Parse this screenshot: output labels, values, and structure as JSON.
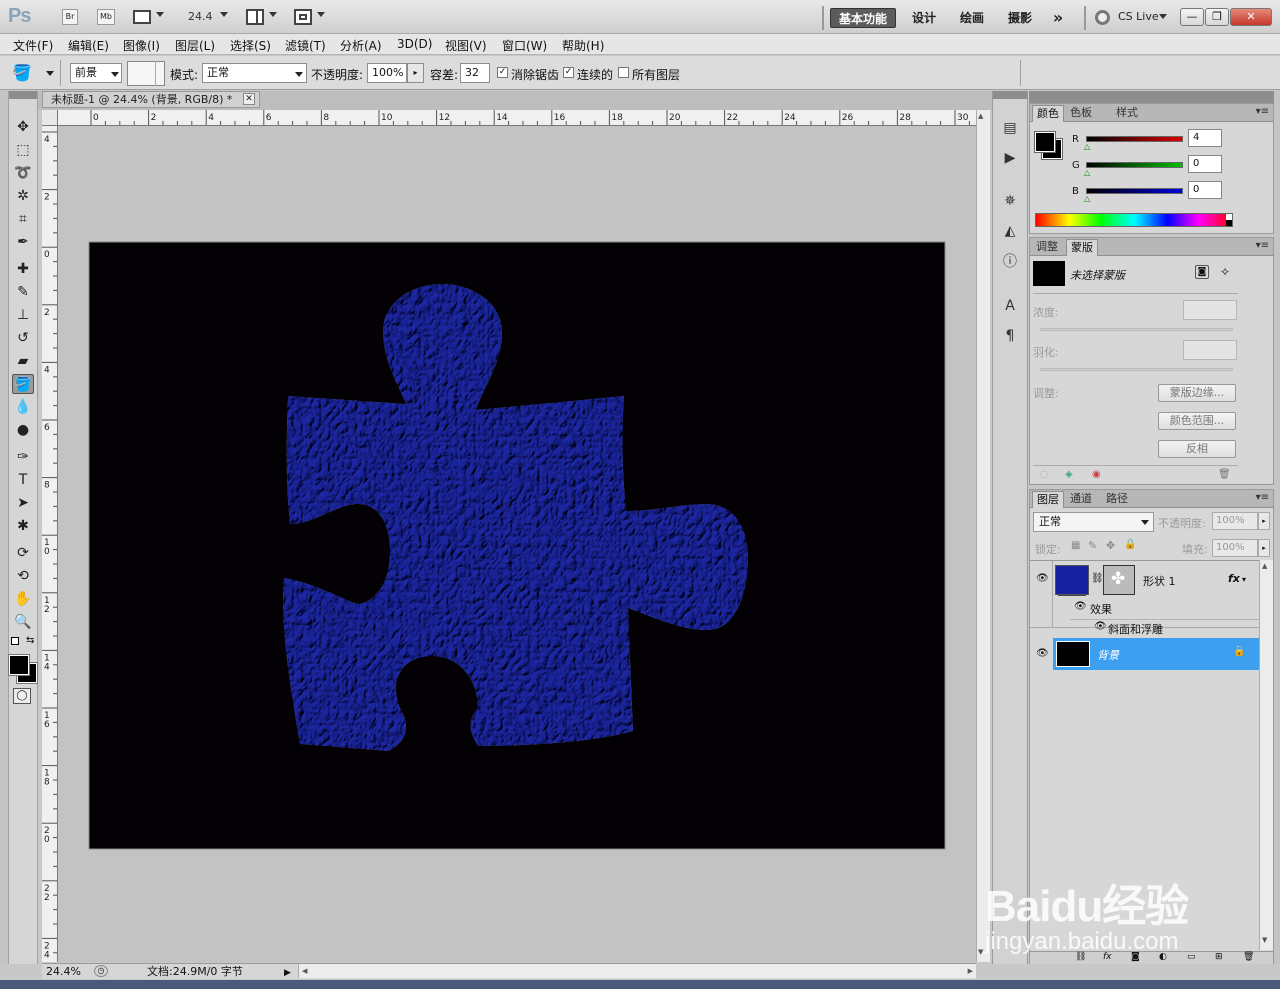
{
  "app": {
    "logo": "Ps",
    "bridge_label": "Br",
    "minibridge_label": "Mb",
    "zoom_level": "24.4",
    "workspaces": [
      "基本功能",
      "设计",
      "绘画",
      "摄影"
    ],
    "more_workspaces": "»",
    "cs_live": "CS Live",
    "window_buttons": [
      "minimize",
      "restore",
      "close"
    ]
  },
  "menu": [
    "文件(F)",
    "编辑(E)",
    "图像(I)",
    "图层(L)",
    "选择(S)",
    "滤镜(T)",
    "分析(A)",
    "3D(D)",
    "视图(V)",
    "窗口(W)",
    "帮助(H)"
  ],
  "options": {
    "fill_source": "前景",
    "mode_label": "模式:",
    "mode_value": "正常",
    "opacity_label": "不透明度:",
    "opacity_value": "100%",
    "tolerance_label": "容差:",
    "tolerance_value": "32",
    "antialias_label": "消除锯齿",
    "antialias_checked": true,
    "contiguous_label": "连续的",
    "contiguous_checked": true,
    "all_layers_label": "所有图层",
    "all_layers_checked": false
  },
  "document": {
    "tab_title": "未标题-1 @ 24.4% (背景, RGB/8) *",
    "ruler_h_labels": [
      "0",
      "2",
      "4",
      "6",
      "8",
      "10",
      "12",
      "14",
      "16",
      "18",
      "20",
      "22",
      "24",
      "26",
      "28",
      "30"
    ],
    "ruler_v_labels": [
      "4",
      "2",
      "0",
      "2",
      "4",
      "6",
      "8",
      "10",
      "12",
      "14",
      "16",
      "18",
      "20",
      "22",
      "24"
    ],
    "canvas_color": "#030104",
    "shape_color": "#2e3aa8",
    "zoom_status": "24.4%",
    "doc_size": "文档:24.9M/0 字节"
  },
  "color_panel": {
    "tabs": [
      "颜色",
      "色板",
      "样式"
    ],
    "active_tab": "颜色",
    "channels": [
      {
        "name": "R",
        "value": "4",
        "color": "#e00000"
      },
      {
        "name": "G",
        "value": "0",
        "color": "#00c000"
      },
      {
        "name": "B",
        "value": "0",
        "color": "#0000e0"
      }
    ]
  },
  "masks_panel": {
    "tabs": [
      "调整",
      "蒙版"
    ],
    "active_tab": "蒙版",
    "mask_label": "未选择蒙版",
    "density_label": "浓度:",
    "feather_label": "羽化:",
    "refine_label": "调整:",
    "buttons": [
      "蒙版边缘...",
      "颜色范围...",
      "反相"
    ]
  },
  "layers_panel": {
    "tabs": [
      "图层",
      "通道",
      "路径"
    ],
    "active_tab": "图层",
    "blend_mode": "正常",
    "opacity_label": "不透明度:",
    "opacity_value": "100%",
    "lock_label": "锁定:",
    "fill_label": "填充:",
    "fill_value": "100%",
    "layers": [
      {
        "name": "形状 1",
        "fx": "fx",
        "effects_label": "效果",
        "effect": "斜面和浮雕",
        "thumb_color": "#1521a0",
        "selected": false
      },
      {
        "name": "背景",
        "thumb_color": "#000000",
        "selected": true,
        "locked": true
      }
    ],
    "selected_color": "#3d9ff0"
  },
  "watermark": {
    "logo": "Baidu经验",
    "url": "jingyan.baidu.com"
  }
}
